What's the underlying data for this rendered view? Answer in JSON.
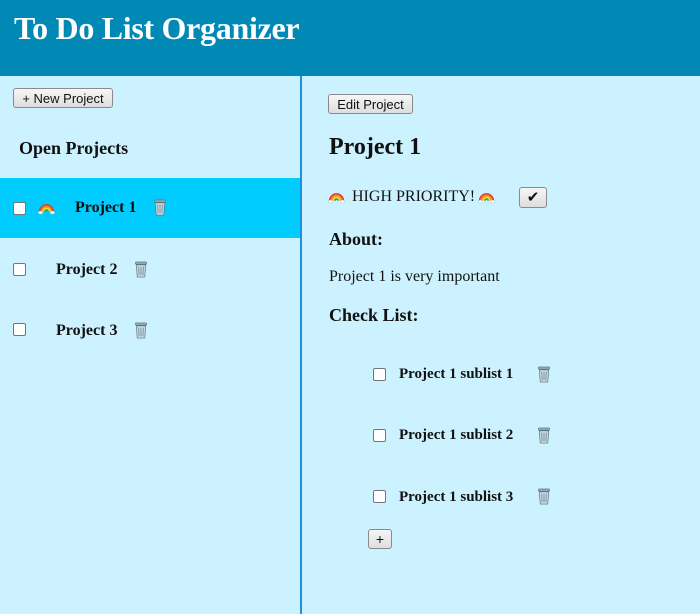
{
  "app": {
    "title": "To Do List Organizer"
  },
  "sidebar": {
    "new_project_label": "+ New Project",
    "heading": "Open Projects",
    "projects": [
      {
        "name": "Project 1",
        "selected": true,
        "high_priority": true,
        "checked": false
      },
      {
        "name": "Project 2",
        "selected": false,
        "high_priority": false,
        "checked": false
      },
      {
        "name": "Project 3",
        "selected": false,
        "high_priority": false,
        "checked": false
      }
    ]
  },
  "detail": {
    "edit_label": "Edit Project",
    "title": "Project 1",
    "priority_text": "HIGH PRIORITY!",
    "priority_toggle_label": "✔",
    "about_heading": "About:",
    "about_text": "Project 1 is very important",
    "checklist_heading": "Check List:",
    "checklist": [
      {
        "label": "Project 1 sublist 1",
        "checked": false
      },
      {
        "label": "Project 1 sublist 2",
        "checked": false
      },
      {
        "label": "Project 1 sublist 3",
        "checked": false
      }
    ],
    "add_item_label": "+"
  },
  "icons": {
    "priority": "rainbow-icon",
    "delete": "trash-icon"
  },
  "colors": {
    "header_bg": "#0089b5",
    "page_bg": "#cdf2ff",
    "selected_row_bg": "#00ccff",
    "divider": "#1f8fe0"
  }
}
